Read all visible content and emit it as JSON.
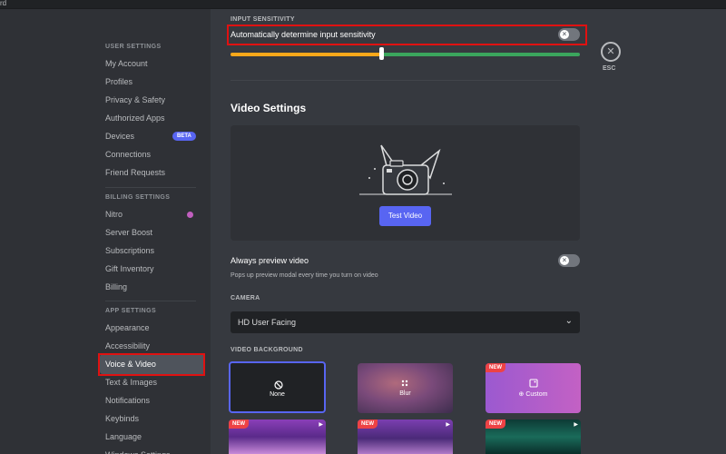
{
  "titlebar": {
    "app": "rd"
  },
  "sidebar": {
    "user_settings_header": "USER SETTINGS",
    "user_items": [
      "My Account",
      "Profiles",
      "Privacy & Safety",
      "Authorized Apps",
      "Devices",
      "Connections",
      "Friend Requests"
    ],
    "beta_badge": "BETA",
    "billing_settings_header": "BILLING SETTINGS",
    "billing_items": [
      "Nitro",
      "Server Boost",
      "Subscriptions",
      "Gift Inventory",
      "Billing"
    ],
    "app_settings_header": "APP SETTINGS",
    "app_items": [
      "Appearance",
      "Accessibility",
      "Voice & Video",
      "Text & Images",
      "Notifications",
      "Keybinds",
      "Language",
      "Windows Settings"
    ],
    "active_item": "Voice & Video"
  },
  "input_sensitivity": {
    "header": "INPUT SENSITIVITY",
    "auto_label": "Automatically determine input sensitivity",
    "auto_enabled": false,
    "slider_level_fraction": 0.43
  },
  "esc": {
    "label": "ESC"
  },
  "video": {
    "title": "Video Settings",
    "test_button": "Test Video",
    "always_preview_label": "Always preview video",
    "always_preview_enabled": false,
    "always_preview_desc": "Pops up preview modal every time you turn on video",
    "camera_header": "CAMERA",
    "camera_value": "HD User Facing",
    "background_header": "VIDEO BACKGROUND",
    "backgrounds": [
      {
        "label": "None",
        "selected": true
      },
      {
        "label": "Blur"
      },
      {
        "label": "Custom",
        "badge": "NEW"
      }
    ],
    "badge_new": "NEW"
  },
  "colors": {
    "accent": "#5865f2",
    "highlight": "#e01111",
    "slider_low": "#faa81a",
    "slider_high": "#3ba55d",
    "new_badge": "#ed4245"
  }
}
